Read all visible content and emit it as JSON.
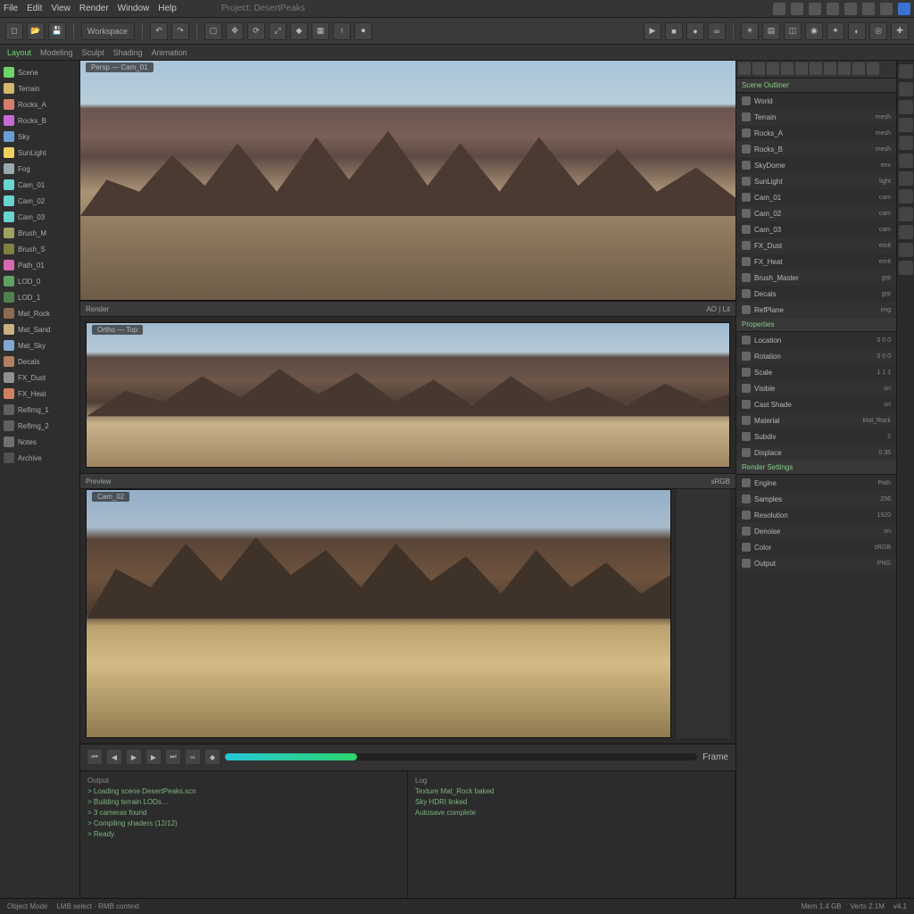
{
  "menubar": {
    "items": [
      "File",
      "Edit",
      "View",
      "Render",
      "Window",
      "Help"
    ],
    "project_label": "Project: DesertPeaks",
    "status_icons": [
      "save-icon",
      "sync-icon",
      "cloud-icon",
      "settings-icon",
      "notify-icon",
      "updates-icon",
      "link-icon",
      "user-icon"
    ]
  },
  "toolbar": {
    "group1": [
      "new",
      "open",
      "save",
      "undo",
      "redo"
    ],
    "dropdown1": "Workspace",
    "group2": [
      "select",
      "move",
      "rotate",
      "scale",
      "snap",
      "grid",
      "meas",
      "cam"
    ],
    "group3": [
      "play",
      "stop",
      "rec",
      "loop",
      "cfg",
      "lit",
      "tex",
      "wire",
      "shade",
      "fx",
      "ao",
      "dof"
    ]
  },
  "tabstrip": {
    "tabs": [
      "Layout",
      "Modeling",
      "Sculpt",
      "Shading",
      "Animation"
    ]
  },
  "left_rail": {
    "items": [
      {
        "label": "Scene",
        "color": "#6bd46b"
      },
      {
        "label": "Terrain",
        "color": "#d4b86b"
      },
      {
        "label": "Rocks_A",
        "color": "#d47e6b"
      },
      {
        "label": "Rocks_B",
        "color": "#c76bd4"
      },
      {
        "label": "Sky",
        "color": "#6b9ed4"
      },
      {
        "label": "SunLight",
        "color": "#f0d060"
      },
      {
        "label": "Fog",
        "color": "#9aa8b0"
      },
      {
        "label": "Cam_01",
        "color": "#6bd4cf"
      },
      {
        "label": "Cam_02",
        "color": "#6bd4cf"
      },
      {
        "label": "Cam_03",
        "color": "#6bd4cf"
      },
      {
        "label": "Brush_M",
        "color": "#a0a060"
      },
      {
        "label": "Brush_S",
        "color": "#808040"
      },
      {
        "label": "Path_01",
        "color": "#d46bb0"
      },
      {
        "label": "LOD_0",
        "color": "#60a060"
      },
      {
        "label": "LOD_1",
        "color": "#508050"
      },
      {
        "label": "Mat_Rock",
        "color": "#8c6b50"
      },
      {
        "label": "Mat_Sand",
        "color": "#c8b080"
      },
      {
        "label": "Mat_Sky",
        "color": "#80a8d0"
      },
      {
        "label": "Decals",
        "color": "#b08060"
      },
      {
        "label": "FX_Dust",
        "color": "#909090"
      },
      {
        "label": "FX_Heat",
        "color": "#d08060"
      },
      {
        "label": "RefImg_1",
        "color": "#606060"
      },
      {
        "label": "RefImg_2",
        "color": "#606060"
      },
      {
        "label": "Notes",
        "color": "#707070"
      },
      {
        "label": "Archive",
        "color": "#505050"
      }
    ]
  },
  "viewports": {
    "top_label": "Persp — Cam_01",
    "mid_header_left": "Render",
    "mid_header_right": "AO | Lit",
    "mid_label": "Ortho — Top",
    "bot_header_left": "Preview",
    "bot_header_right": "sRGB",
    "bot_label": "Cam_02"
  },
  "timeline": {
    "buttons": [
      "start",
      "prev",
      "play",
      "next",
      "end",
      "loop",
      "key",
      "mute"
    ],
    "frame_label": "Frame",
    "progress": 28
  },
  "console": {
    "col1_title": "Output",
    "col1": [
      "> Loading scene DesertPeaks.scn",
      "> Building terrain LODs…",
      "> 3 cameras found",
      "> Compiling shaders (12/12)",
      "> Ready."
    ],
    "col2_title": "Log",
    "col2": [
      "Texture Mat_Rock baked",
      "Sky HDRI linked",
      "Autosave complete"
    ]
  },
  "inspector": {
    "micro_btns": [
      "a",
      "b",
      "c",
      "d",
      "e",
      "f",
      "g",
      "h",
      "i",
      "j"
    ],
    "section1": "Scene Outliner",
    "items1": [
      {
        "label": "World",
        "val": ""
      },
      {
        "label": "Terrain",
        "val": "mesh"
      },
      {
        "label": "Rocks_A",
        "val": "mesh"
      },
      {
        "label": "Rocks_B",
        "val": "mesh"
      },
      {
        "label": "SkyDome",
        "val": "env"
      },
      {
        "label": "SunLight",
        "val": "light"
      },
      {
        "label": "Cam_01",
        "val": "cam"
      },
      {
        "label": "Cam_02",
        "val": "cam"
      },
      {
        "label": "Cam_03",
        "val": "cam"
      },
      {
        "label": "FX_Dust",
        "val": "emit"
      },
      {
        "label": "FX_Heat",
        "val": "emit"
      },
      {
        "label": "Brush_Master",
        "val": "grp"
      },
      {
        "label": "Decals",
        "val": "grp"
      },
      {
        "label": "RefPlane",
        "val": "img"
      }
    ],
    "section2": "Properties",
    "items2": [
      {
        "label": "Location",
        "val": "0 0 0"
      },
      {
        "label": "Rotation",
        "val": "0 0 0"
      },
      {
        "label": "Scale",
        "val": "1 1 1"
      },
      {
        "label": "Visible",
        "val": "on"
      },
      {
        "label": "Cast Shade",
        "val": "on"
      },
      {
        "label": "Material",
        "val": "Mat_Rock"
      },
      {
        "label": "Subdiv",
        "val": "2"
      },
      {
        "label": "Displace",
        "val": "0.35"
      }
    ],
    "section3": "Render Settings",
    "items3": [
      {
        "label": "Engine",
        "val": "Path"
      },
      {
        "label": "Samples",
        "val": "256"
      },
      {
        "label": "Resolution",
        "val": "1920"
      },
      {
        "label": "Denoise",
        "val": "on"
      },
      {
        "label": "Color",
        "val": "sRGB"
      },
      {
        "label": "Output",
        "val": "PNG"
      }
    ]
  },
  "right_rail2": {
    "btns": [
      "scene",
      "render",
      "output",
      "layers",
      "world",
      "obj",
      "mod",
      "part",
      "phys",
      "constr",
      "mat",
      "tex"
    ]
  },
  "statusbar": {
    "left": "Object Mode",
    "hint": "LMB select · RMB context",
    "mem": "Mem 1.4 GB",
    "verts": "Verts 2.1M",
    "version": "v4.1"
  }
}
